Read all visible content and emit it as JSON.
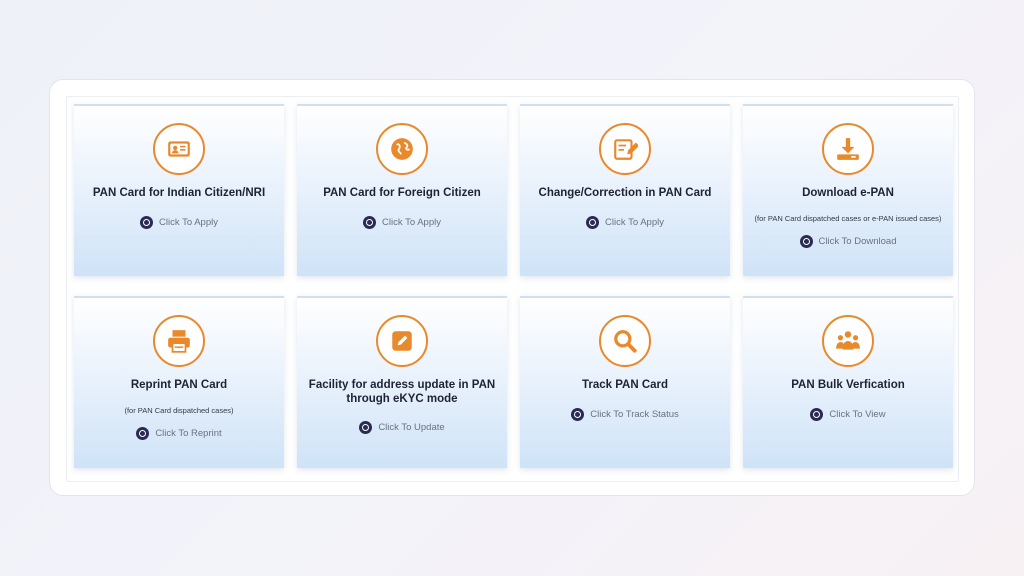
{
  "cards": [
    {
      "title": "PAN Card for Indian Citizen/NRI",
      "note": "",
      "action": "Click To Apply",
      "icon": "id-card-icon"
    },
    {
      "title": "PAN Card for Foreign Citizen",
      "note": "",
      "action": "Click To Apply",
      "icon": "globe-icon"
    },
    {
      "title": "Change/Correction in PAN Card",
      "note": "",
      "action": "Click To Apply",
      "icon": "edit-document-icon"
    },
    {
      "title": "Download e-PAN",
      "note": "(for PAN Card dispatched cases or e-PAN issued cases)",
      "action": "Click To Download",
      "icon": "download-icon"
    },
    {
      "title": "Reprint PAN Card",
      "note": "(for PAN Card dispatched cases)",
      "action": "Click To Reprint",
      "icon": "printer-icon"
    },
    {
      "title": "Facility for address update in PAN through eKYC mode",
      "note": "",
      "action": "Click To Update",
      "icon": "pencil-square-icon"
    },
    {
      "title": "Track PAN Card",
      "note": "",
      "action": "Click To Track Status",
      "icon": "search-icon"
    },
    {
      "title": "PAN Bulk Verfication",
      "note": "",
      "action": "Click To View",
      "icon": "users-group-icon"
    }
  ],
  "colors": {
    "accent": "#e8892c",
    "action_dot": "#2a2b55",
    "title": "#1e2235"
  }
}
